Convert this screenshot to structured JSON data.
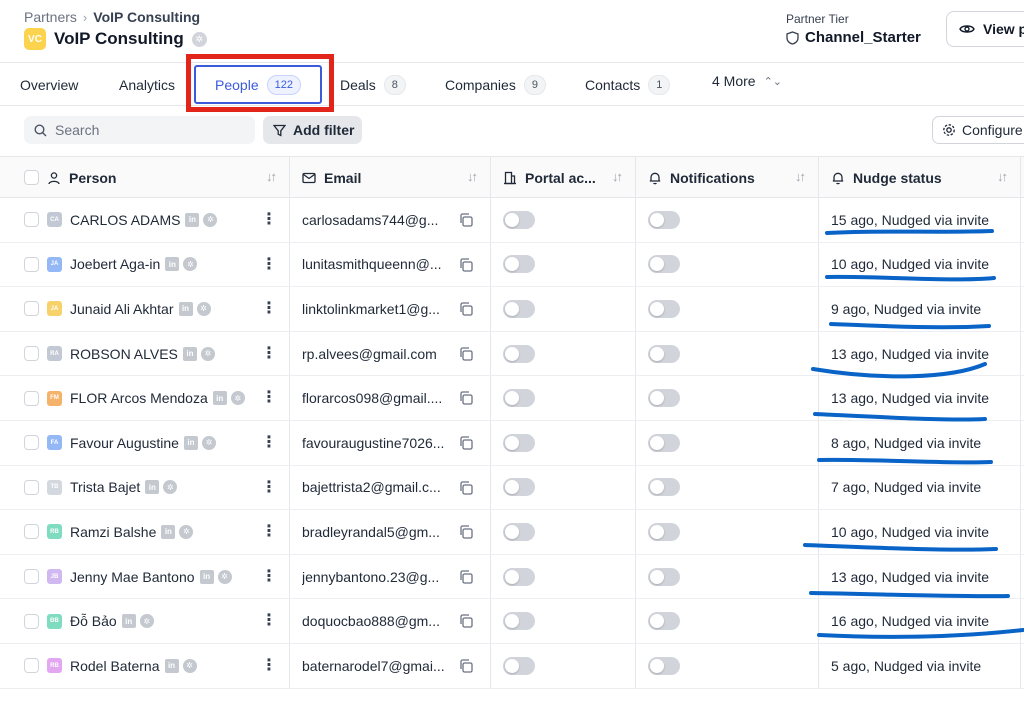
{
  "breadcrumb": {
    "root": "Partners",
    "current": "VoIP Consulting"
  },
  "org": {
    "logo_text": "VC",
    "name": "VoIP Consulting"
  },
  "tier": {
    "label": "Partner Tier",
    "value": "Channel_Starter"
  },
  "header": {
    "view_button": "View p"
  },
  "tabs": [
    {
      "label": "Overview",
      "count": ""
    },
    {
      "label": "Analytics",
      "count": ""
    },
    {
      "label": "People",
      "count": "122"
    },
    {
      "label": "Deals",
      "count": "8"
    },
    {
      "label": "Companies",
      "count": "9"
    },
    {
      "label": "Contacts",
      "count": "1"
    },
    {
      "label": "4 More",
      "count": ""
    }
  ],
  "toolbar": {
    "search_placeholder": "Search",
    "filter_label": "Add filter",
    "configure_label": "Configure"
  },
  "columns": {
    "person": "Person",
    "email": "Email",
    "portal": "Portal ac...",
    "notifications": "Notifications",
    "nudge": "Nudge status"
  },
  "rows": [
    {
      "initials": "CA",
      "avatar_color": "#c3c9d4",
      "name": "CARLOS ADAMS",
      "email": "carlosadams744@g...",
      "nudge": "15 ago, Nudged via invite"
    },
    {
      "initials": "JA",
      "avatar_color": "#93b8f5",
      "name": "Joebert Aga-in",
      "email": "lunitasmithqueenn@...",
      "nudge": "10 ago, Nudged via invite"
    },
    {
      "initials": "JA",
      "avatar_color": "#f7d26b",
      "name": "Junaid Ali Akhtar",
      "email": "linktolinkmarket1@g...",
      "nudge": "9 ago, Nudged via invite"
    },
    {
      "initials": "RA",
      "avatar_color": "#c3c9d4",
      "name": "ROBSON ALVES",
      "email": "rp.alvees@gmail.com",
      "nudge": "13 ago, Nudged via invite"
    },
    {
      "initials": "FM",
      "avatar_color": "#f5b26b",
      "name": "FLOR Arcos Mendoza",
      "email": "florarcos098@gmail....",
      "nudge": "13 ago, Nudged via invite"
    },
    {
      "initials": "FA",
      "avatar_color": "#93b8f5",
      "name": "Favour Augustine",
      "email": "favouraugustine7026...",
      "nudge": "8 ago, Nudged via invite"
    },
    {
      "initials": "TB",
      "avatar_color": "#d3d7de",
      "name": "Trista Bajet",
      "email": "bajettrista2@gmail.c...",
      "nudge": "7 ago, Nudged via invite"
    },
    {
      "initials": "RB",
      "avatar_color": "#7fdcc0",
      "name": "Ramzi Balshe",
      "email": "bradleyrandal5@gm...",
      "nudge": "10 ago, Nudged via invite"
    },
    {
      "initials": "JB",
      "avatar_color": "#d0b8f0",
      "name": "Jenny Mae Bantono",
      "email": "jennybantono.23@g...",
      "nudge": "13 ago, Nudged via invite"
    },
    {
      "initials": "ĐB",
      "avatar_color": "#7fdcc0",
      "name": "Đỗ Bảo",
      "email": "doquocbao888@gm...",
      "nudge": "16 ago, Nudged via invite"
    },
    {
      "initials": "RB",
      "avatar_color": "#e3a6f0",
      "name": "Rodel Baterna",
      "email": "baternarodel7@gmai...",
      "nudge": "5 ago, Nudged via invite"
    }
  ],
  "colors": {
    "accent": "#3b5bdb",
    "annotation_box": "#e1251b",
    "annotation_ink": "#0a64c8"
  }
}
